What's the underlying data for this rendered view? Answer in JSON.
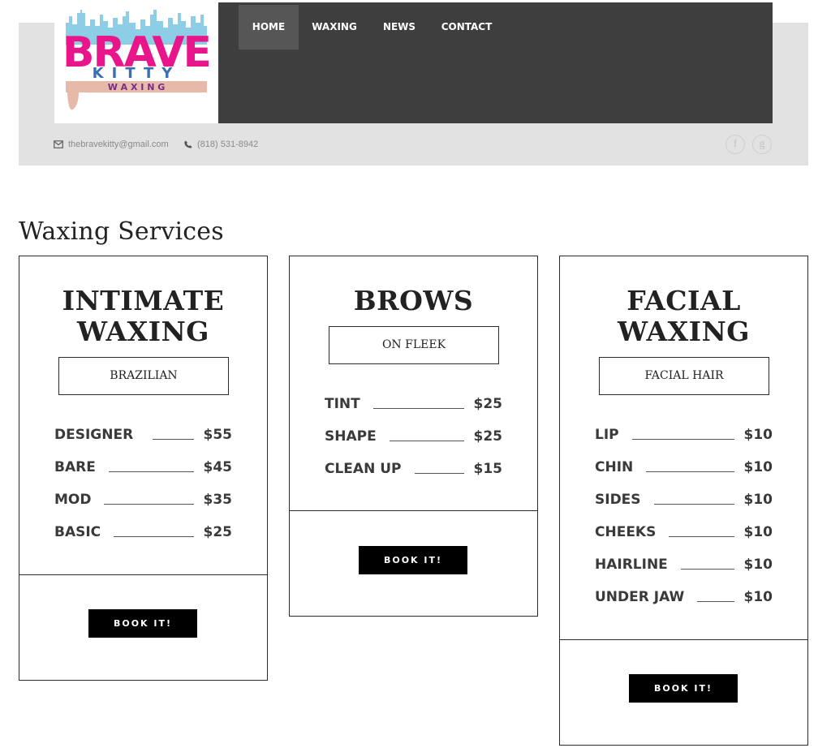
{
  "brand": {
    "logo_word": "BRAVE",
    "logo_sub": "KITTY",
    "logo_tag": "W A X I N G"
  },
  "nav": [
    {
      "label": "HOME",
      "active": true
    },
    {
      "label": "WAXING",
      "active": false
    },
    {
      "label": "NEWS",
      "active": false
    },
    {
      "label": "CONTACT",
      "active": false
    }
  ],
  "contact": {
    "email": "thebravekitty@gmail.com",
    "phone": "(818) 531-8942"
  },
  "social": {
    "facebook": "f",
    "google": "g"
  },
  "section_title": "Waxing Services",
  "cards": [
    {
      "title_line1": "INTIMATE",
      "title_line2": "WAXING",
      "subtitle": "BRAZILIAN",
      "items": [
        {
          "label": "DESIGNER",
          "price": "$55"
        },
        {
          "label": "BARE",
          "price": "$45"
        },
        {
          "label": "MOD",
          "price": "$35"
        },
        {
          "label": "BASIC",
          "price": "$25"
        }
      ],
      "button": "BOOK IT!"
    },
    {
      "title_line1": "BROWS",
      "subtitle": "ON FLEEK",
      "items": [
        {
          "label": "TINT",
          "price": "$25"
        },
        {
          "label": "SHAPE",
          "price": "$25"
        },
        {
          "label": "CLEAN UP",
          "price": "$15"
        }
      ],
      "button": "BOOK IT!"
    },
    {
      "title_line1": "FACIAL",
      "title_line2": "WAXING",
      "subtitle": "FACIAL HAIR",
      "items": [
        {
          "label": "LIP",
          "price": "$10"
        },
        {
          "label": "CHIN",
          "price": "$10"
        },
        {
          "label": "SIDES",
          "price": "$10"
        },
        {
          "label": "CHEEKS",
          "price": "$10"
        },
        {
          "label": "HAIRLINE",
          "price": "$10"
        },
        {
          "label": "UNDER JAW",
          "price": "$10"
        }
      ],
      "button": "BOOK IT!"
    }
  ],
  "colors": {
    "navbar": "#3e3e3e",
    "nav_active": "#565656",
    "header_bg": "#e2e2e2",
    "logo_pink": "#e8168a",
    "logo_sky": "#8ecde6",
    "button": "#000000"
  }
}
